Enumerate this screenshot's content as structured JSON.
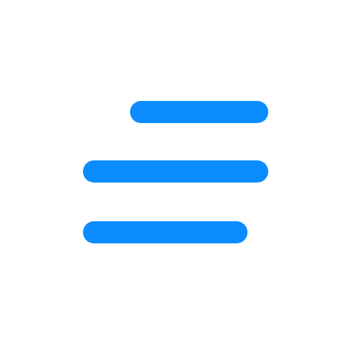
{
  "icon": {
    "name": "menu-align-right-icon",
    "color": "#0A8CFF",
    "background": "#FFFFFF"
  }
}
